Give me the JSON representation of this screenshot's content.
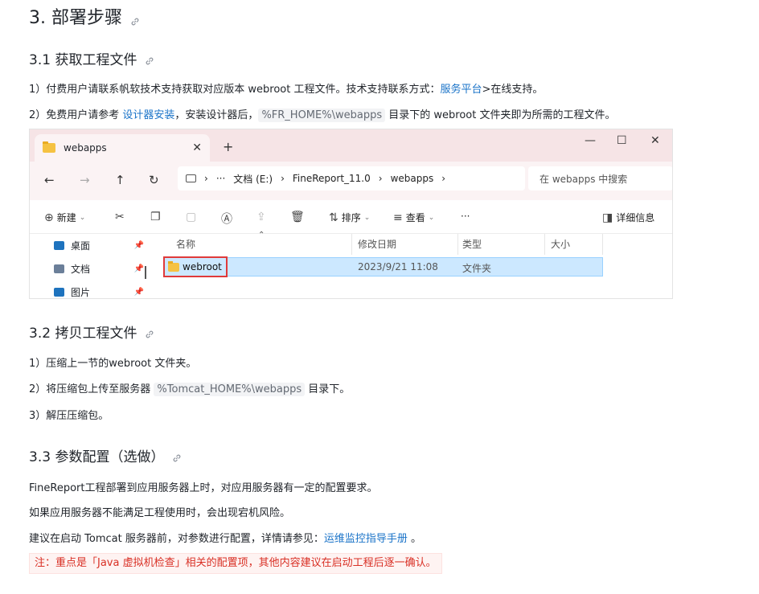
{
  "heading": "3. 部署步骤",
  "s31": {
    "title": "3.1 获取工程文件",
    "p1": {
      "a": "1）付费用户请联系帆软技术支持获取对应版本 webroot 工程文件。技术支持联系方式：",
      "link": "服务平台",
      "b": ">在线支持。"
    },
    "p2": {
      "a": "2）免费用户请参考 ",
      "link": "设计器安装",
      "b": "，安装设计器后，",
      "code": "%FR_HOME%\\webapps",
      "c": " 目录下的 webroot 文件夹即为所需的工程文件。"
    }
  },
  "explorer": {
    "tab_label": "webapps",
    "tab_close": "✕",
    "new_tab": "+",
    "win_min": "—",
    "win_max": "☐",
    "win_close": "✕",
    "nav": {
      "back": "←",
      "forward": "→",
      "up": "↑",
      "refresh": "↻"
    },
    "breadcrumb": [
      "›",
      "···",
      "文档 (E:)",
      "›",
      "FineReport_11.0",
      "›",
      "webapps",
      "›"
    ],
    "search_placeholder": "在 webapps 中搜索",
    "toolbar": {
      "new": "新建",
      "sort": "排序",
      "view": "查看",
      "more": "···",
      "details": "详细信息"
    },
    "nav_items": [
      {
        "label": "桌面",
        "color": "#1e73be"
      },
      {
        "label": "文档",
        "color": "#6b7f99"
      },
      {
        "label": "图片",
        "color": "#1e73be"
      }
    ],
    "columns": [
      "名称",
      "修改日期",
      "类型",
      "大小"
    ],
    "row": {
      "name": "webroot",
      "date": "2023/9/21 11:08",
      "type": "文件夹",
      "size": ""
    }
  },
  "s32": {
    "title": "3.2 拷贝工程文件",
    "p1": "1）压缩上一节的webroot 文件夹。",
    "p2": {
      "a": "2）将压缩包上传至服务器 ",
      "code": "%Tomcat_HOME%\\webapps",
      "b": " 目录下。"
    },
    "p3": "3）解压压缩包。"
  },
  "s33": {
    "title": "3.3 参数配置（选做）",
    "p1": "FineReport工程部署到应用服务器上时，对应用服务器有一定的配置要求。",
    "p2": "如果应用服务器不能满足工程使用时，会出现宕机风险。",
    "p3": {
      "a": "建议在启动 Tomcat 服务器前，对参数进行配置，详情请参见：",
      "link": "运维监控指导手册",
      "b": " 。"
    },
    "note": "注：重点是「Java 虚拟机检查」相关的配置项，其他内容建议在启动工程后逐一确认。"
  }
}
